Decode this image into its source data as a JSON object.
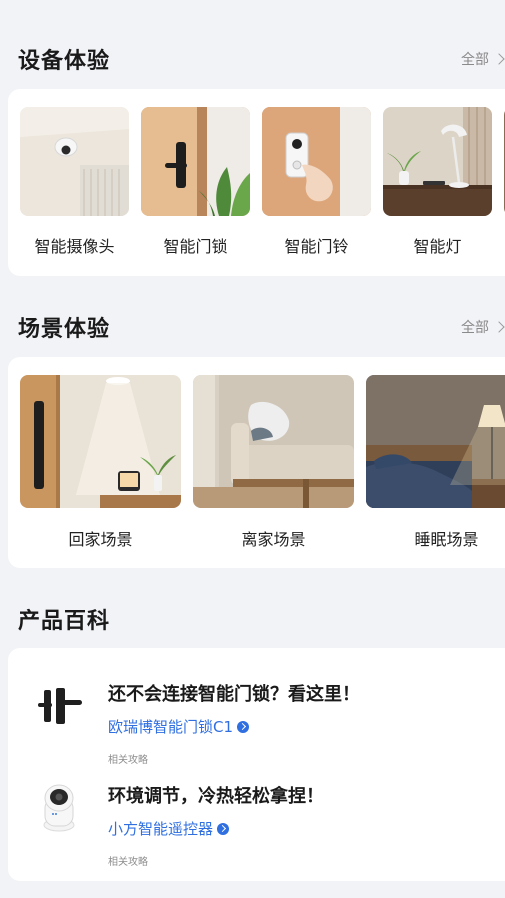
{
  "devices": {
    "title": "设备体验",
    "all_label": "全部",
    "items": [
      {
        "label": "智能摄像头",
        "icon": "camera-icon"
      },
      {
        "label": "智能门锁",
        "icon": "door-lock-icon"
      },
      {
        "label": "智能门铃",
        "icon": "doorbell-icon"
      },
      {
        "label": "智能灯",
        "icon": "lamp-icon"
      }
    ]
  },
  "scenes": {
    "title": "场景体验",
    "all_label": "全部",
    "items": [
      {
        "label": "回家场景"
      },
      {
        "label": "离家场景"
      },
      {
        "label": "睡眠场景"
      }
    ]
  },
  "encyclopedia": {
    "title": "产品百科",
    "items": [
      {
        "title": "还不会连接智能门锁？看这里！",
        "link": "欧瑞博智能门锁C1",
        "tag": "相关攻略",
        "icon": "door-lock-icon"
      },
      {
        "title": "环境调节，冷热轻松拿捏！",
        "link": "小方智能遥控器",
        "tag": "相关攻略",
        "icon": "camera-icon"
      }
    ]
  },
  "colors": {
    "link": "#2f6fe0",
    "background": "#f2f3f7",
    "card": "#ffffff"
  }
}
